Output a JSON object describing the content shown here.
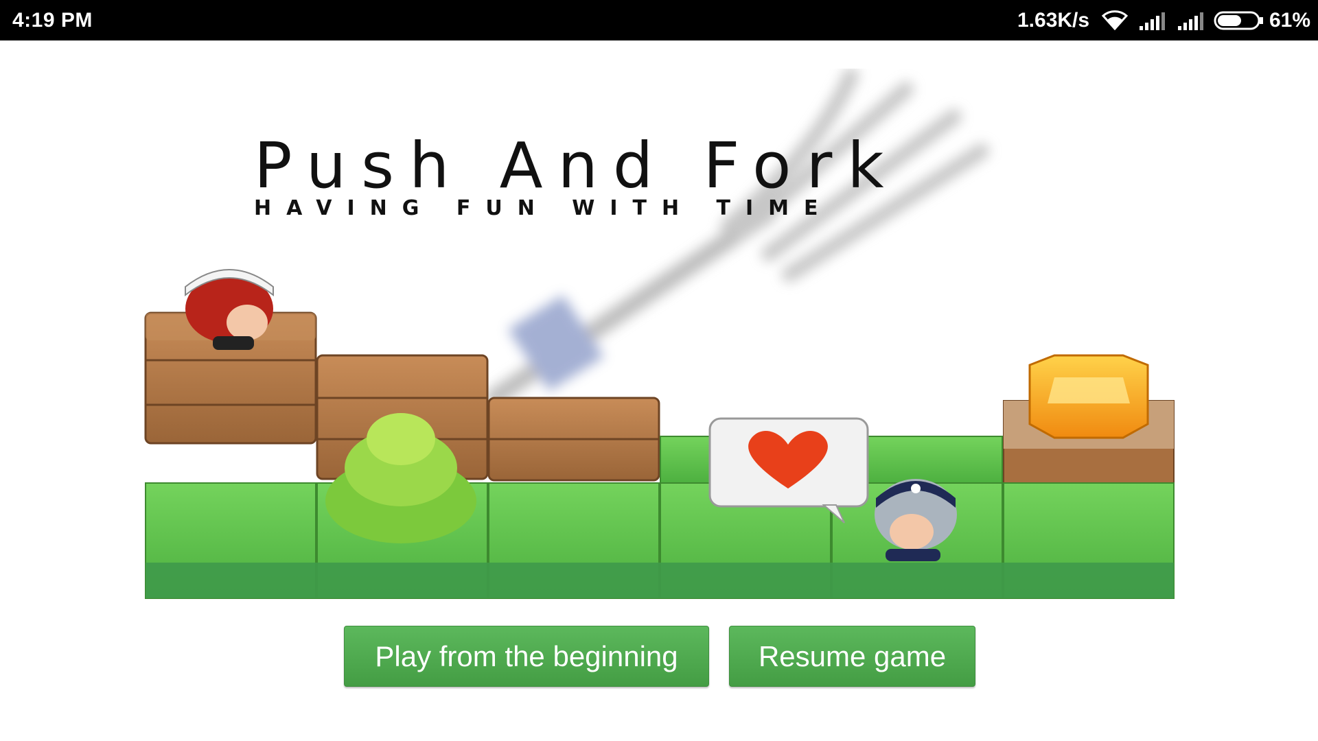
{
  "status_bar": {
    "time": "4:19 PM",
    "net_speed": "1.63K/s",
    "battery": "61%",
    "battery_level": 0.61,
    "icons": [
      "wifi-icon",
      "cell-signal-icon",
      "cell-signal-icon",
      "battery-icon"
    ]
  },
  "game": {
    "title": "Push And Fork",
    "subtitle": "HAVING FUN WITH TIME"
  },
  "buttons": {
    "play": "Play from the beginning",
    "resume": "Resume game"
  },
  "colors": {
    "button_green": "#5cb85c",
    "grass": "#5cc04a",
    "wood": "#b07a4a",
    "gem": "#f2a21a"
  }
}
